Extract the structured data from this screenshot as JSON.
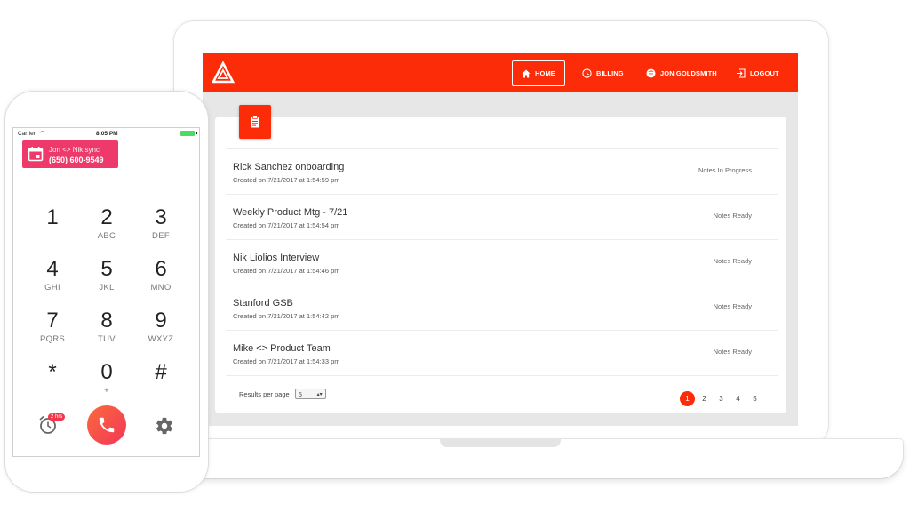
{
  "colors": {
    "brand": "#fc2b08",
    "call_banner": "#ee3a6b",
    "battery": "#4cd964"
  },
  "nav": {
    "items": [
      {
        "label": "HOME",
        "icon": "home-icon",
        "active": true
      },
      {
        "label": "BILLING",
        "icon": "clock-icon"
      },
      {
        "label": "JON GOLDSMITH",
        "icon": "user-avatar-icon"
      },
      {
        "label": "LOGOUT",
        "icon": "logout-icon"
      }
    ]
  },
  "notes": [
    {
      "title": "Rick Sanchez onboarding",
      "created": "Created on 7/21/2017 at 1:54:59 pm",
      "status": "Notes In Progress"
    },
    {
      "title": "Weekly Product Mtg - 7/21",
      "created": "Created on 7/21/2017 at 1:54:54 pm",
      "status": "Notes Ready"
    },
    {
      "title": "Nik Liolios Interview",
      "created": "Created on 7/21/2017 at 1:54:46 pm",
      "status": "Notes Ready"
    },
    {
      "title": "Stanford GSB",
      "created": "Created on 7/21/2017 at 1:54:42 pm",
      "status": "Notes Ready"
    },
    {
      "title": "Mike <> Product Team",
      "created": "Created on 7/21/2017 at 1:54:33 pm",
      "status": "Notes Ready"
    }
  ],
  "pagination": {
    "results_label": "Results per page",
    "results_value": "5",
    "pages": [
      "1",
      "2",
      "3",
      "4",
      "5"
    ],
    "current": "1"
  },
  "phone": {
    "carrier": "Carrier",
    "time": "8:05 PM",
    "banner": {
      "line1": "Jon <> Nik sync",
      "line2": "(650) 600-9549"
    },
    "keys": [
      {
        "digit": "1",
        "letters": ""
      },
      {
        "digit": "2",
        "letters": "ABC"
      },
      {
        "digit": "3",
        "letters": "DEF"
      },
      {
        "digit": "4",
        "letters": "GHI"
      },
      {
        "digit": "5",
        "letters": "JKL"
      },
      {
        "digit": "6",
        "letters": "MNO"
      },
      {
        "digit": "7",
        "letters": "PQRS"
      },
      {
        "digit": "8",
        "letters": "TUV"
      },
      {
        "digit": "9",
        "letters": "WXYZ"
      },
      {
        "digit": "*",
        "letters": ""
      },
      {
        "digit": "0",
        "letters": "+"
      },
      {
        "digit": "#",
        "letters": ""
      }
    ],
    "alarm_badge": "2 hrs"
  }
}
